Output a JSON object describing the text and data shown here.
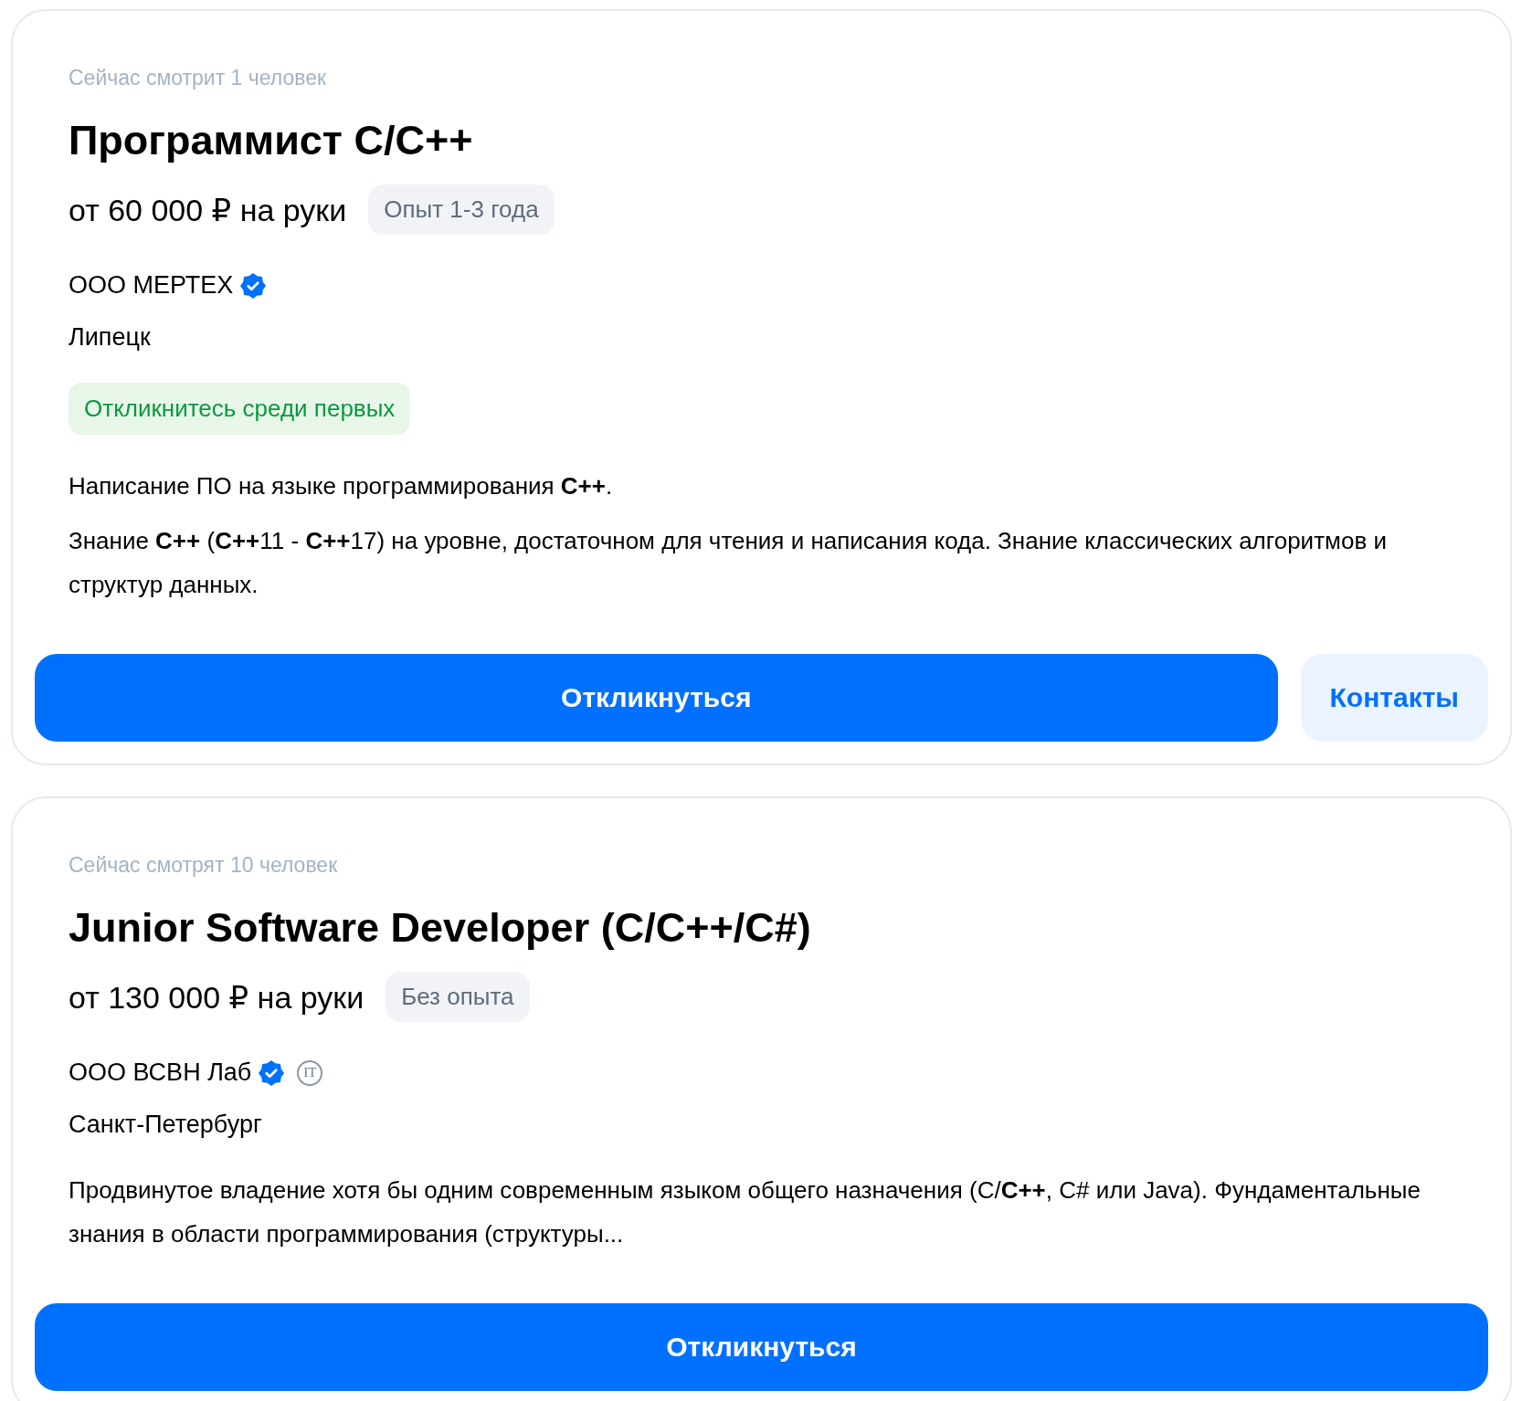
{
  "vacancies": [
    {
      "viewers": "Сейчас смотрит 1 человек",
      "title": "Программист C/C++",
      "salary": "от 60 000 ₽ на руки",
      "experience": "Опыт 1-3 года",
      "company": "ООО МЕРТЕХ",
      "verified": true,
      "city": "Липецк",
      "highlight": "Откликнитесь среди первых",
      "description": [
        "Написание ПО на языке программирования **C++**.",
        "Знание **C++** (**C++**11 - **C++**17) на уровне, достаточном для чтения и написания кода. Знание классических алгоритмов и структур данных."
      ],
      "actions": [
        {
          "kind": "primary",
          "label": "Откликнуться"
        },
        {
          "kind": "secondary",
          "label": "Контакты"
        }
      ]
    },
    {
      "viewers": "Сейчас смотрят 10 человек",
      "title": "Junior Software Developer (C/C++/C#)",
      "salary": "от 130 000 ₽ на руки",
      "experience": "Без опыта",
      "company": "ООО ВСВН Лаб",
      "verified": true,
      "it_mark": "IT",
      "city": "Санкт-Петербург",
      "description": [
        "Продвинутое владение хотя бы одним современным языком общего назначения (C/**C++**, C# или Java). Фундаментальные знания в области программирования (структуры..."
      ],
      "actions": [
        {
          "kind": "primary",
          "label": "Откликнуться"
        }
      ]
    }
  ]
}
